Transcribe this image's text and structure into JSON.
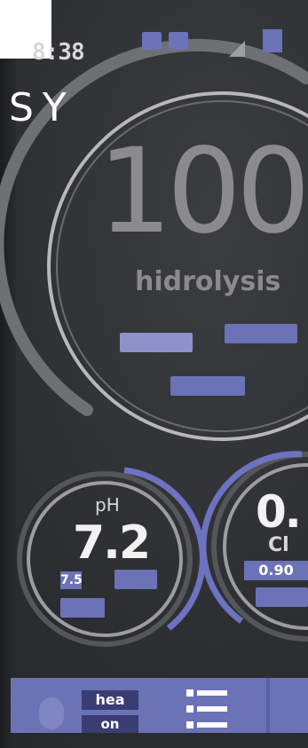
{
  "brand": {
    "text": "SY"
  },
  "status": {
    "time": "8:38",
    "battery_icon": "battery-icon",
    "signal_icon": "signal-icon"
  },
  "main_gauge": {
    "value": "100",
    "label": "hidrolysis",
    "level": 1.0
  },
  "ph_gauge": {
    "label": "pH",
    "value": "7.2",
    "setpoint": "7.5"
  },
  "cl_gauge": {
    "value": "0.",
    "label": "Cl",
    "setpoint": "0.90"
  },
  "bottom_nav": {
    "mode_line1": "hea",
    "mode_line2": "on",
    "menu_icon": "list-menu-icon"
  },
  "colors": {
    "accent": "#6c72b6",
    "gauge_grey": "#8b8b8f",
    "background": "#2e3034"
  }
}
